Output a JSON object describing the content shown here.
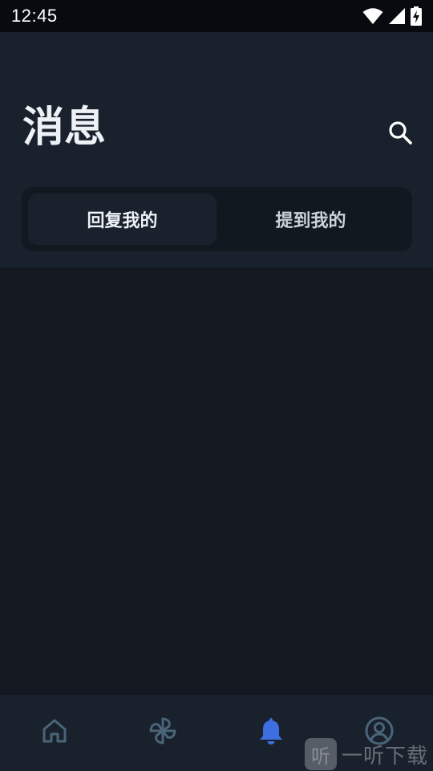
{
  "status_bar": {
    "time": "12:45",
    "icons": [
      "wifi-icon",
      "signal-icon",
      "battery-charging-icon"
    ]
  },
  "header": {
    "title": "消息",
    "search_icon": "search-icon"
  },
  "tabs": [
    {
      "label": "回复我的",
      "active": true
    },
    {
      "label": "提到我的",
      "active": false
    }
  ],
  "bottom_nav": {
    "items": [
      {
        "icon": "home-icon",
        "active": false
      },
      {
        "icon": "pinwheel-icon",
        "active": false
      },
      {
        "icon": "bell-icon",
        "active": true
      },
      {
        "icon": "user-circle-icon",
        "active": false
      }
    ]
  },
  "watermark": {
    "logo_char": "听",
    "text": "一听下载"
  },
  "colors": {
    "header_bg": "#19212c",
    "content_bg": "#131821",
    "accent": "#3d6fe0",
    "inactive_icon": "#4a6478"
  }
}
